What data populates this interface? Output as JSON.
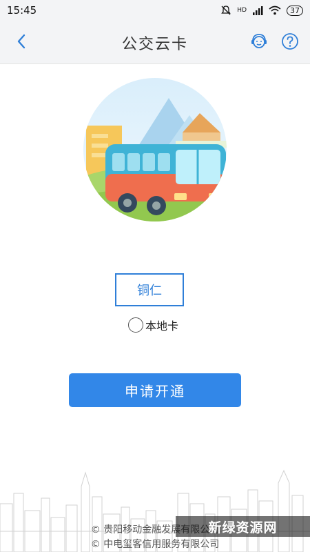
{
  "status_bar": {
    "time": "15:45",
    "network": "HD",
    "battery": "37"
  },
  "header": {
    "title": "公交云卡"
  },
  "city": {
    "selected": "铜仁"
  },
  "card_option": {
    "label": "本地卡"
  },
  "apply_button": {
    "label": "申请开通"
  },
  "footer": {
    "line1": "© 贵阳移动金融发展有限公司",
    "line2": "© 中电玺客信用服务有限公司"
  },
  "watermark": {
    "text": "新绿资源网"
  },
  "colors": {
    "accent": "#3287e8",
    "bar_bg": "#f3f4f6"
  }
}
